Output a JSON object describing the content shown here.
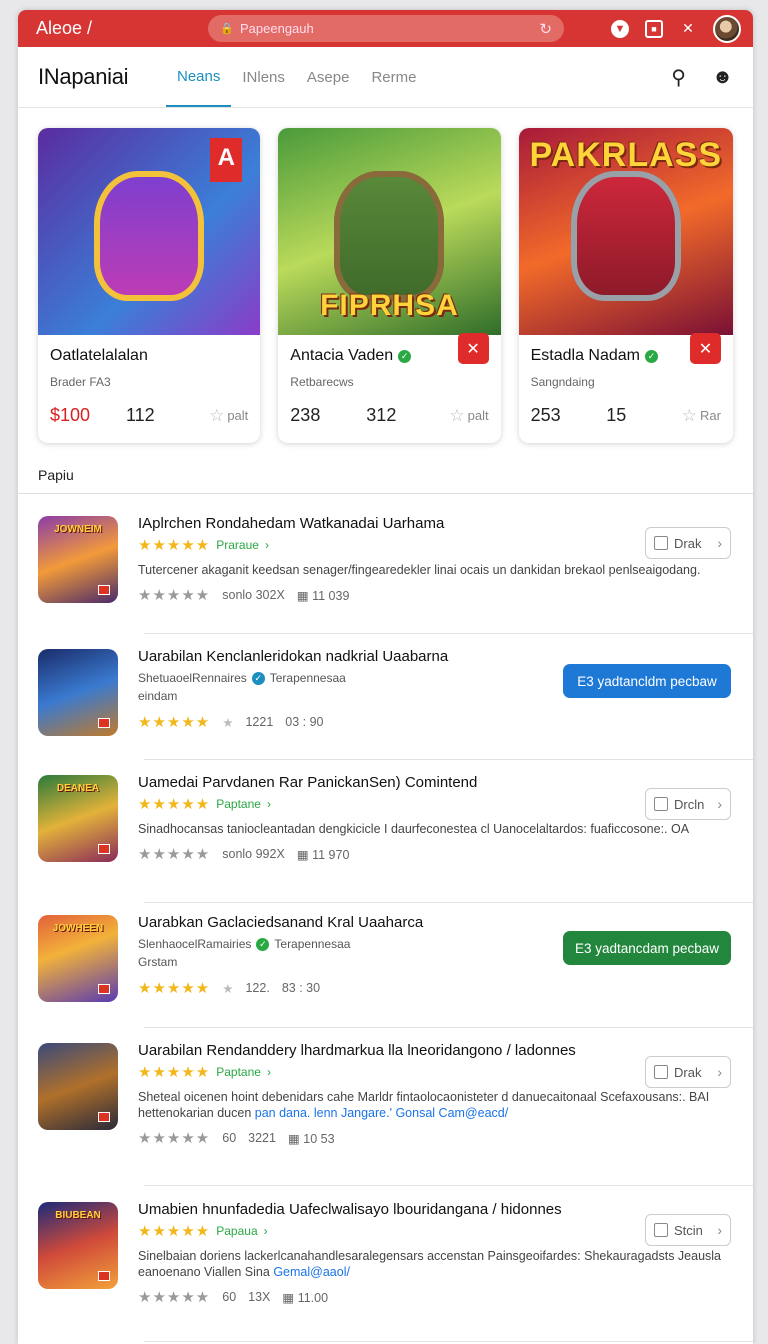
{
  "topbar": {
    "brand": "Aleoe /",
    "url_placeholder": "Papeengauh",
    "icons": [
      "lock-icon",
      "reload-icon",
      "chevron-down-icon",
      "window-icon",
      "tools-icon",
      "avatar"
    ]
  },
  "nav": {
    "title": "INapaniai",
    "tabs": [
      {
        "label": "Neans",
        "active": true
      },
      {
        "label": "INlens",
        "active": false
      },
      {
        "label": "Asepe",
        "active": false
      },
      {
        "label": "Rerme",
        "active": false
      }
    ]
  },
  "featured": [
    {
      "art_text": "A",
      "name": "Oatlatelalalan",
      "sub": "Brader FA3",
      "price": "$100",
      "n1": "112",
      "n2": "",
      "rate": "palt",
      "verified": false
    },
    {
      "art_text": "FIPRHSA",
      "name": "Antacia Vaden",
      "sub": "Retbarecws",
      "price": "",
      "n1": "238",
      "n2": "312",
      "rate": "palt",
      "verified": true
    },
    {
      "art_text": "PAKRLASS",
      "name": "Estadla Nadam",
      "sub": "Sangndaing",
      "price": "",
      "n1": "253",
      "n2": "15",
      "rate": "Rar",
      "verified": true
    }
  ],
  "section_label": "Papiu",
  "list": [
    {
      "thumb_text": "JOWNEIM",
      "title": "IAplrchen Rondahedam Watkanadai Uarhama",
      "tag": "Praraue",
      "desc": "Tutercener akaganit keedsan senager/fingearedekler linai ocais un dankidan brekaol penlseaigodang.",
      "meta1": "sonlo 302X",
      "meta2": "11 039",
      "button": "Drak"
    },
    {
      "thumb_text": "",
      "title": "Uarabilan Kenclanleridokan nadkrial Uaabarna",
      "sub1": "ShetuaoelRennaires",
      "sub1b": "Terapennesaa",
      "sub2": "eindam",
      "meta1": "1221",
      "meta2": "03 : 90",
      "button": "E3 yadtancldm pecbaw"
    },
    {
      "thumb_text": "DEANEA",
      "title": "Uamedai Parvdanen Rar PanickanSen) Comintend",
      "tag": "Paptane",
      "desc": "Sinadhocansas taniocleantadan dengkicicle I daurfeconestea cl Uanocelaltardos: fuaficcosone:. OA",
      "meta1": "sonlo 992X",
      "meta2": "11 970",
      "button": "Drcln"
    },
    {
      "thumb_text": "JOWHEEN",
      "title": "Uarabkan Gaclaciedsanand Kral Uaaharca",
      "sub1": "SlenhaocelRamairies",
      "sub1b": "Terapennesaa",
      "sub2": "Grstam",
      "meta1": "122.",
      "meta2": "83 : 30",
      "button": "E3 yadtancdam pecbaw"
    },
    {
      "thumb_text": "",
      "title": "Uarabilan Rendanddery lhardmarkua lla lneoridangono / ladonnes",
      "tag": "Paptane",
      "desc": "Sheteal oicenen hoint debenidars cahe Marldr fintaolocaonisteter d danuecaitonaal Scefaxousans:. BAI hettenokarian ducen",
      "desc_link": "pan dana. lenn Jangare.' Gonsal Cam@eacd/",
      "meta1": "60",
      "meta1b": "3221",
      "meta2": "10 53",
      "button": "Drak"
    },
    {
      "thumb_text": "BIUBEAN",
      "title": "Umabien hnunfadedia Uafeclwalisayo lbouridangana / hidonnes",
      "tag": "Papaua",
      "desc": "Sinelbaian doriens lackerlcanahandlesaralegensars accenstan Painsgeoifardes: Shekauragadsts Jeausla eanoenano Viallen Sina",
      "desc_link": "Gemal@aaol/",
      "meta1": "60",
      "meta1b": "13X",
      "meta2": "11.00",
      "button": "Stcin"
    }
  ],
  "colors": {
    "brand": "#d63533",
    "accent": "#1d8fbf",
    "star": "#f2b71a",
    "verified": "#2aa844",
    "blue_button": "#1e78d6",
    "green_button": "#22873c"
  }
}
